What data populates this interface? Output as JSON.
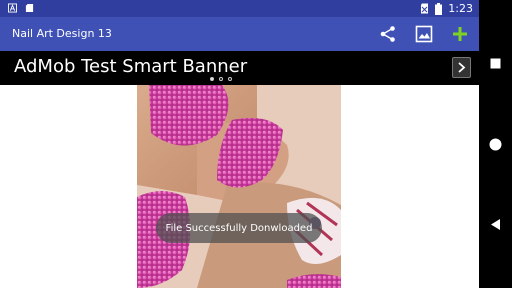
{
  "status_bar": {
    "time": "1:23"
  },
  "app_bar": {
    "title": "Nail Art Design 13"
  },
  "ad_banner": {
    "text": "AdMob Test Smart Banner"
  },
  "toast": {
    "message": "File Successfully Donwloaded"
  },
  "colors": {
    "status_bar": "#303f9f",
    "app_bar": "#3f51b5",
    "add_icon": "#7ed321",
    "toast_bg": "#505050"
  },
  "icons": [
    "notification-a-icon",
    "sd-card-icon",
    "no-sim-icon",
    "battery-icon",
    "share-icon",
    "image-icon",
    "add-icon",
    "chevron-right-icon",
    "recents-icon",
    "home-icon",
    "back-icon"
  ]
}
